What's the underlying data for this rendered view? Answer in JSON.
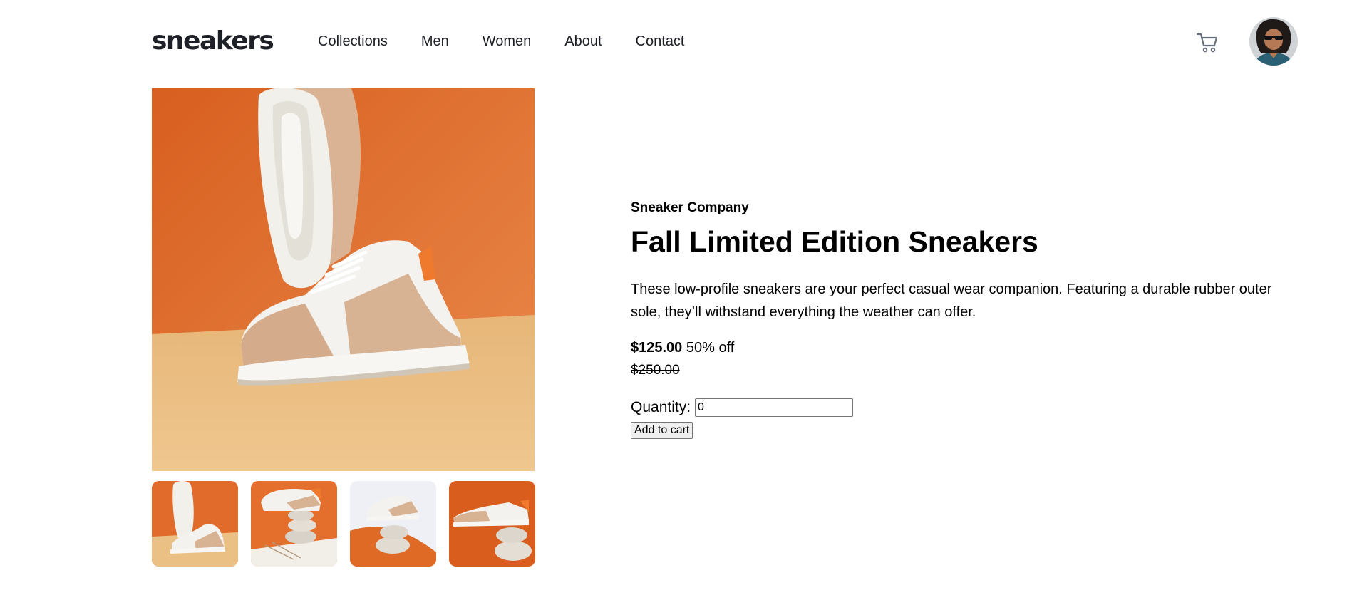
{
  "header": {
    "logo": "sneakers",
    "nav": [
      "Collections",
      "Men",
      "Women",
      "About",
      "Contact"
    ],
    "cart_icon": "cart-icon",
    "avatar_icon": "user-avatar"
  },
  "product": {
    "company": "Sneaker Company",
    "title": "Fall Limited Edition Sneakers",
    "description": "These low-profile sneakers are your perfect casual wear companion. Featuring a durable rubber outer sole, they’ll withstand everything the weather can offer.",
    "price": "$125.00",
    "discount": "50% off",
    "original_price": "$250.00",
    "quantity_label": "Quantity:",
    "quantity_value": "0",
    "add_to_cart_label": "Add to cart"
  },
  "gallery": {
    "thumbnail_count": 4
  },
  "colors": {
    "orange": "#e06b2a",
    "sand": "#e9bd82",
    "text_dark": "#1d2026"
  }
}
